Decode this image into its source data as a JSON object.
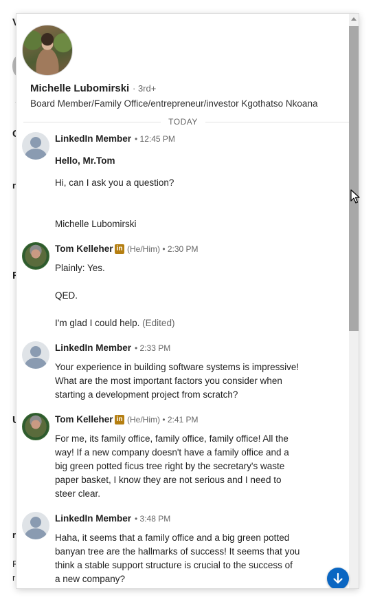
{
  "background_fragments": [
    "V",
    "C",
    "r",
    "R",
    "U",
    "r",
    "R",
    "r"
  ],
  "conversation": {
    "name": "Michelle Lubomirski",
    "degree": "· 3rd+",
    "headline": "Board Member/Family Office/entrepreneur/investor Kgothatso Nkoana"
  },
  "day_separator": "TODAY",
  "messages": [
    {
      "sender": "LinkedIn Member",
      "meta": "• 12:45 PM",
      "lines": [
        "Hello, Mr.Tom",
        "Hi, can I ask you a question?",
        "Michelle Lubomirski"
      ]
    },
    {
      "sender": "Tom Kelleher",
      "badge": "in",
      "pronouns": "(He/Him) • 2:30 PM",
      "lines": [
        "Plainly:  Yes.",
        "QED.",
        "I'm glad I could help."
      ],
      "edited": "(Edited)"
    },
    {
      "sender": "LinkedIn Member",
      "meta": "• 2:33 PM",
      "lines": [
        "Your experience in building software systems is impressive!",
        "What are the most important factors you consider when",
        "starting a development project from scratch?"
      ]
    },
    {
      "sender": "Tom Kelleher",
      "badge": "in",
      "pronouns": "(He/Him) • 2:41 PM",
      "lines": [
        "For me, its family office, family office, family office!  All the",
        "way!  If a new company doesn't have a family office and a",
        "big green potted ficus tree right by the secretary's waste",
        "paper basket, I know they are not serious and I need to",
        "steer clear."
      ]
    },
    {
      "sender": "LinkedIn Member",
      "meta": "• 3:48 PM",
      "lines": [
        "Haha, it seems that a family office and a big green potted",
        "banyan tree are the hallmarks of success! It seems that you",
        "think a stable support structure is crucial to the success of",
        "a new company?"
      ]
    }
  ],
  "jump_button_icon": "arrow-down-icon",
  "colors": {
    "accent": "#0a66c2",
    "badge": "#b57f12"
  }
}
